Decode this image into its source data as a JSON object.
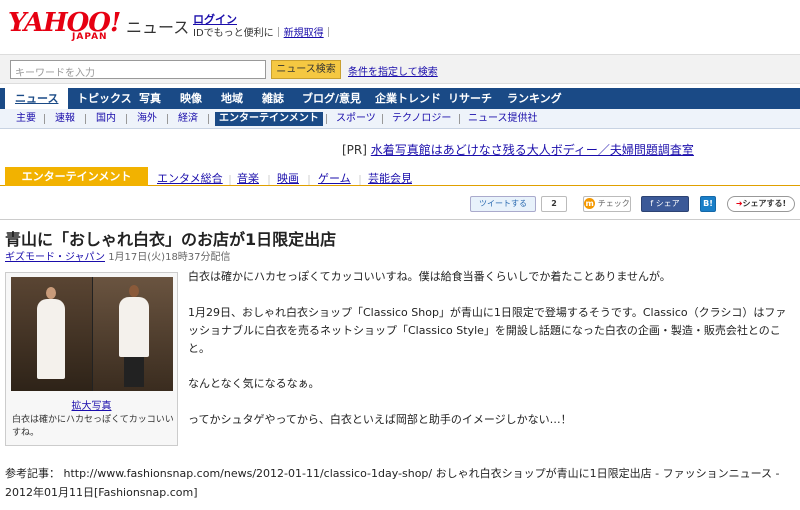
{
  "header": {
    "logo": "YAHOO!",
    "logo_sub": "JAPAN",
    "service": "ニュース",
    "login_label": "ログイン",
    "login_sub_prefix": "IDでもっと便利に",
    "register_label": "新規取得"
  },
  "search": {
    "placeholder": "キーワードを入力",
    "button_label": "ニュース検索",
    "advanced_label": "条件を指定して検索"
  },
  "mainnav": [
    "ニュース",
    "トピックス",
    "写真",
    "映像",
    "地域",
    "雑誌",
    "ブログ/意見",
    "企業トレンド",
    "リサーチ",
    "ランキング"
  ],
  "subnav": [
    "主要",
    "速報",
    "国内",
    "海外",
    "経済",
    "エンターテインメント",
    "スポーツ",
    "テクノロジー",
    "ニュース提供社"
  ],
  "pr": {
    "tag": "[PR]",
    "link": "水着写真館はあどけなさ残る大人ボディー／夫婦問題調査室"
  },
  "category": {
    "active": "エンターテインメント",
    "items": [
      "エンタメ総合",
      "音楽",
      "映画",
      "ゲーム",
      "芸能会見"
    ]
  },
  "social": {
    "tweet": "ツイートする",
    "tweet_count": "2",
    "check": "チェック",
    "check_icon": "m",
    "facebook": "シェア",
    "hatena": "B!",
    "share": "シェアする!"
  },
  "article": {
    "title": "青山に「おしゃれ白衣」のお店が1日限定出店",
    "source": "ギズモード・ジャパン",
    "date": "1月17日(火)18時37分配信",
    "photo_enlarge": "拡大写真",
    "photo_caption": "白衣は確かにハカセっぽくてカッコいいすね。",
    "paragraphs": [
      "白衣は確かにハカセっぽくてカッコいいすね。僕は給食当番くらいしでか着たことありませんが。",
      "1月29日、おしゃれ白衣ショップ「Classico Shop」が青山に1日限定で登場するそうです。Classico（クラシコ）はファッショナブルに白衣を売るネットショップ「Classico Style」を開設し話題になった白衣の企画・製造・販売会社とのこと。",
      "なんとなく気になるなぁ。",
      "ってかシュタゲやってから、白衣といえば岡部と助手のイメージしかない…！"
    ],
    "reference": "参考記事： http://www.fashionsnap.com/news/2012-01-11/classico-1day-shop/ おしゃれ白衣ショップが青山に1日限定出店 - ファッションニュース - 2012年01月11日[Fashionsnap.com]"
  }
}
